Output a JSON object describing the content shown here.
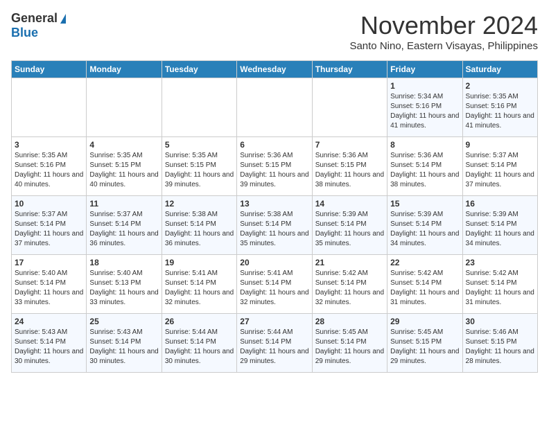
{
  "header": {
    "logo_general": "General",
    "logo_blue": "Blue",
    "month_title": "November 2024",
    "location": "Santo Nino, Eastern Visayas, Philippines"
  },
  "days_of_week": [
    "Sunday",
    "Monday",
    "Tuesday",
    "Wednesday",
    "Thursday",
    "Friday",
    "Saturday"
  ],
  "weeks": [
    [
      {
        "day": "",
        "sunrise": "",
        "sunset": "",
        "daylight": ""
      },
      {
        "day": "",
        "sunrise": "",
        "sunset": "",
        "daylight": ""
      },
      {
        "day": "",
        "sunrise": "",
        "sunset": "",
        "daylight": ""
      },
      {
        "day": "",
        "sunrise": "",
        "sunset": "",
        "daylight": ""
      },
      {
        "day": "",
        "sunrise": "",
        "sunset": "",
        "daylight": ""
      },
      {
        "day": "1",
        "sunrise": "Sunrise: 5:34 AM",
        "sunset": "Sunset: 5:16 PM",
        "daylight": "Daylight: 11 hours and 41 minutes."
      },
      {
        "day": "2",
        "sunrise": "Sunrise: 5:35 AM",
        "sunset": "Sunset: 5:16 PM",
        "daylight": "Daylight: 11 hours and 41 minutes."
      }
    ],
    [
      {
        "day": "3",
        "sunrise": "Sunrise: 5:35 AM",
        "sunset": "Sunset: 5:16 PM",
        "daylight": "Daylight: 11 hours and 40 minutes."
      },
      {
        "day": "4",
        "sunrise": "Sunrise: 5:35 AM",
        "sunset": "Sunset: 5:15 PM",
        "daylight": "Daylight: 11 hours and 40 minutes."
      },
      {
        "day": "5",
        "sunrise": "Sunrise: 5:35 AM",
        "sunset": "Sunset: 5:15 PM",
        "daylight": "Daylight: 11 hours and 39 minutes."
      },
      {
        "day": "6",
        "sunrise": "Sunrise: 5:36 AM",
        "sunset": "Sunset: 5:15 PM",
        "daylight": "Daylight: 11 hours and 39 minutes."
      },
      {
        "day": "7",
        "sunrise": "Sunrise: 5:36 AM",
        "sunset": "Sunset: 5:15 PM",
        "daylight": "Daylight: 11 hours and 38 minutes."
      },
      {
        "day": "8",
        "sunrise": "Sunrise: 5:36 AM",
        "sunset": "Sunset: 5:14 PM",
        "daylight": "Daylight: 11 hours and 38 minutes."
      },
      {
        "day": "9",
        "sunrise": "Sunrise: 5:37 AM",
        "sunset": "Sunset: 5:14 PM",
        "daylight": "Daylight: 11 hours and 37 minutes."
      }
    ],
    [
      {
        "day": "10",
        "sunrise": "Sunrise: 5:37 AM",
        "sunset": "Sunset: 5:14 PM",
        "daylight": "Daylight: 11 hours and 37 minutes."
      },
      {
        "day": "11",
        "sunrise": "Sunrise: 5:37 AM",
        "sunset": "Sunset: 5:14 PM",
        "daylight": "Daylight: 11 hours and 36 minutes."
      },
      {
        "day": "12",
        "sunrise": "Sunrise: 5:38 AM",
        "sunset": "Sunset: 5:14 PM",
        "daylight": "Daylight: 11 hours and 36 minutes."
      },
      {
        "day": "13",
        "sunrise": "Sunrise: 5:38 AM",
        "sunset": "Sunset: 5:14 PM",
        "daylight": "Daylight: 11 hours and 35 minutes."
      },
      {
        "day": "14",
        "sunrise": "Sunrise: 5:39 AM",
        "sunset": "Sunset: 5:14 PM",
        "daylight": "Daylight: 11 hours and 35 minutes."
      },
      {
        "day": "15",
        "sunrise": "Sunrise: 5:39 AM",
        "sunset": "Sunset: 5:14 PM",
        "daylight": "Daylight: 11 hours and 34 minutes."
      },
      {
        "day": "16",
        "sunrise": "Sunrise: 5:39 AM",
        "sunset": "Sunset: 5:14 PM",
        "daylight": "Daylight: 11 hours and 34 minutes."
      }
    ],
    [
      {
        "day": "17",
        "sunrise": "Sunrise: 5:40 AM",
        "sunset": "Sunset: 5:14 PM",
        "daylight": "Daylight: 11 hours and 33 minutes."
      },
      {
        "day": "18",
        "sunrise": "Sunrise: 5:40 AM",
        "sunset": "Sunset: 5:13 PM",
        "daylight": "Daylight: 11 hours and 33 minutes."
      },
      {
        "day": "19",
        "sunrise": "Sunrise: 5:41 AM",
        "sunset": "Sunset: 5:14 PM",
        "daylight": "Daylight: 11 hours and 32 minutes."
      },
      {
        "day": "20",
        "sunrise": "Sunrise: 5:41 AM",
        "sunset": "Sunset: 5:14 PM",
        "daylight": "Daylight: 11 hours and 32 minutes."
      },
      {
        "day": "21",
        "sunrise": "Sunrise: 5:42 AM",
        "sunset": "Sunset: 5:14 PM",
        "daylight": "Daylight: 11 hours and 32 minutes."
      },
      {
        "day": "22",
        "sunrise": "Sunrise: 5:42 AM",
        "sunset": "Sunset: 5:14 PM",
        "daylight": "Daylight: 11 hours and 31 minutes."
      },
      {
        "day": "23",
        "sunrise": "Sunrise: 5:42 AM",
        "sunset": "Sunset: 5:14 PM",
        "daylight": "Daylight: 11 hours and 31 minutes."
      }
    ],
    [
      {
        "day": "24",
        "sunrise": "Sunrise: 5:43 AM",
        "sunset": "Sunset: 5:14 PM",
        "daylight": "Daylight: 11 hours and 30 minutes."
      },
      {
        "day": "25",
        "sunrise": "Sunrise: 5:43 AM",
        "sunset": "Sunset: 5:14 PM",
        "daylight": "Daylight: 11 hours and 30 minutes."
      },
      {
        "day": "26",
        "sunrise": "Sunrise: 5:44 AM",
        "sunset": "Sunset: 5:14 PM",
        "daylight": "Daylight: 11 hours and 30 minutes."
      },
      {
        "day": "27",
        "sunrise": "Sunrise: 5:44 AM",
        "sunset": "Sunset: 5:14 PM",
        "daylight": "Daylight: 11 hours and 29 minutes."
      },
      {
        "day": "28",
        "sunrise": "Sunrise: 5:45 AM",
        "sunset": "Sunset: 5:14 PM",
        "daylight": "Daylight: 11 hours and 29 minutes."
      },
      {
        "day": "29",
        "sunrise": "Sunrise: 5:45 AM",
        "sunset": "Sunset: 5:15 PM",
        "daylight": "Daylight: 11 hours and 29 minutes."
      },
      {
        "day": "30",
        "sunrise": "Sunrise: 5:46 AM",
        "sunset": "Sunset: 5:15 PM",
        "daylight": "Daylight: 11 hours and 28 minutes."
      }
    ]
  ]
}
